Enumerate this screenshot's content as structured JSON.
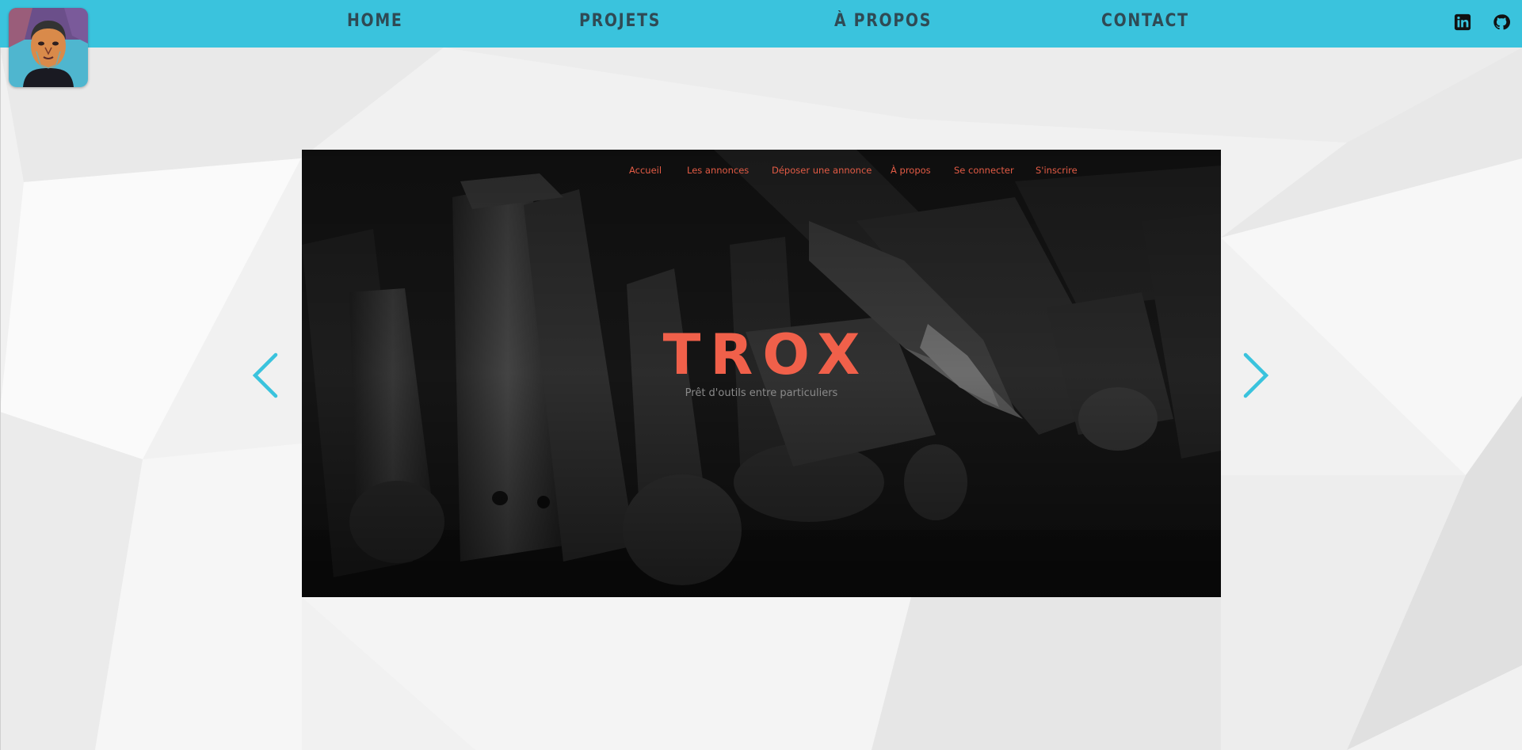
{
  "nav": {
    "items": [
      {
        "label": "HOME"
      },
      {
        "label": "PROJETS"
      },
      {
        "label": "À PROPOS"
      },
      {
        "label": "CONTACT"
      }
    ]
  },
  "social": {
    "linkedin_icon": "linkedin-icon",
    "github_icon": "github-icon"
  },
  "slide": {
    "subnav": [
      {
        "label": "Accueil"
      },
      {
        "label": "Les annonces"
      },
      {
        "label": "Déposer une annonce"
      },
      {
        "label": "À propos"
      },
      {
        "label": "Se connecter"
      },
      {
        "label": "S'inscrire"
      }
    ],
    "title": "TROX",
    "subtitle": "Prêt d'outils entre particuliers"
  },
  "colors": {
    "topbar": "#3ac3dd",
    "nav_text": "#2f4a54",
    "accent": "#f0604a",
    "arrow": "#3ac3dd"
  }
}
